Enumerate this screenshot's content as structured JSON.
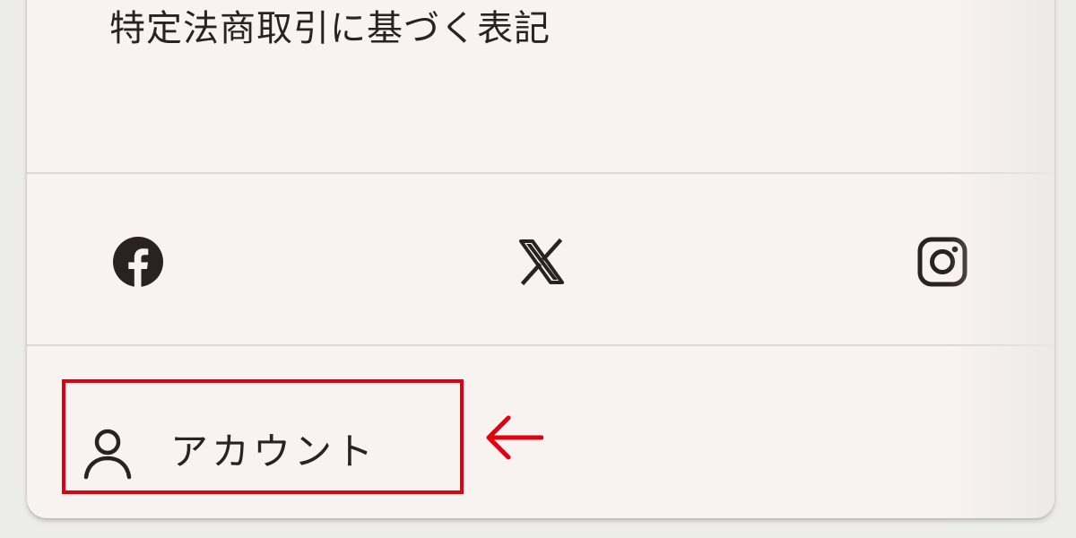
{
  "footer": {
    "legal_link": "特定法商取引に基づく表記",
    "social": [
      {
        "icon": "facebook-icon",
        "label": "Facebook"
      },
      {
        "icon": "x-icon",
        "label": "X"
      },
      {
        "icon": "instagram-icon",
        "label": "Instagram"
      }
    ],
    "account": {
      "icon": "user-icon",
      "label": "アカウント"
    }
  },
  "annotation": {
    "highlight_color": "#e2000f",
    "arrow_icon": "left-arrow-icon"
  },
  "colors": {
    "text": "#2a2121",
    "panel_bg": "#f8f3f1",
    "divider": "#dad6d4"
  }
}
